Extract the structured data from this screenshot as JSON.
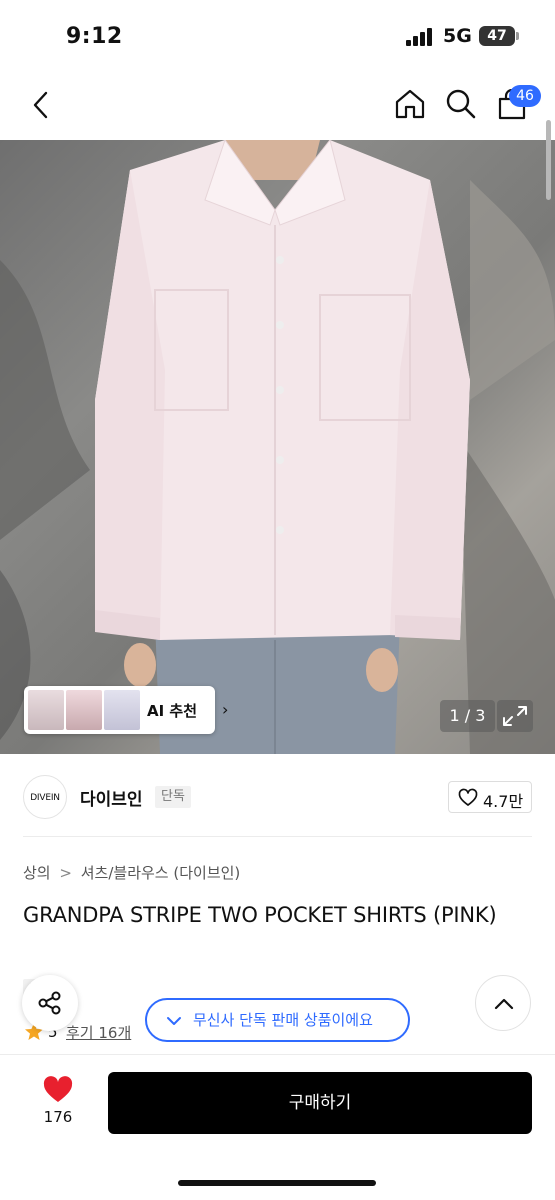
{
  "status_bar": {
    "time": "9:12",
    "network": "5G",
    "battery": "47"
  },
  "header": {
    "cart_count": "46"
  },
  "ai_recommend": {
    "label": "AI 추천",
    "chevron": "›"
  },
  "gallery": {
    "pager": "1 / 3"
  },
  "brand": {
    "logo_text": "DIVEIN",
    "name": "다이브인",
    "tag": "단독",
    "like_count": "4.7만"
  },
  "breadcrumb": {
    "category": "상의",
    "separator": ">",
    "subcategory": "셔츠/블라우스 (다이브인)"
  },
  "product": {
    "title": "GRANDPA STRIPE TWO POCKET SHIRTS (PINK)",
    "tag": "단독"
  },
  "rating": {
    "score": "5",
    "review_label": "후기 16개"
  },
  "toast": {
    "text": "무신사 단독 판매 상품이에요"
  },
  "bottom_bar": {
    "heart_count": "176",
    "buy_label": "구매하기"
  },
  "colors": {
    "accent_blue": "#2f6bff",
    "heart_red": "#e8202e",
    "buy_black": "#000000",
    "star": "#f5a623"
  },
  "icons": [
    "back-icon",
    "home-icon",
    "search-icon",
    "cart-icon",
    "expand-icon",
    "heart-outline-icon",
    "share-icon",
    "chevron-up-icon",
    "check-icon",
    "heart-icon",
    "star-icon"
  ]
}
